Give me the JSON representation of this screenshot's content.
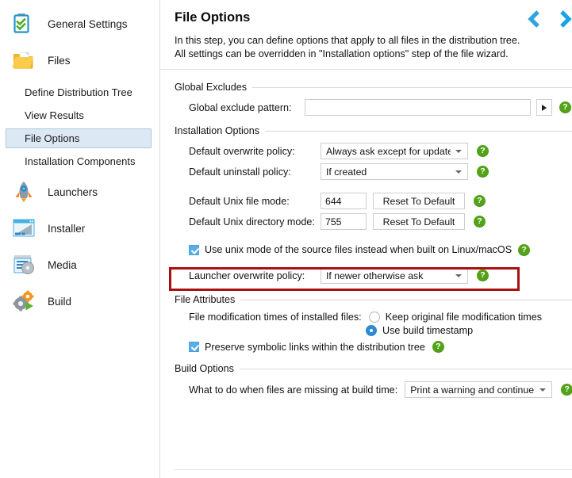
{
  "sidebar": {
    "items": [
      {
        "label": "General Settings",
        "icon": "clipboard-check-icon",
        "type": "major",
        "selected": false
      },
      {
        "label": "Files",
        "icon": "folder-open-icon",
        "type": "major",
        "selected": false
      },
      {
        "label": "Define Distribution Tree",
        "icon": "",
        "type": "sub",
        "selected": false
      },
      {
        "label": "View Results",
        "icon": "",
        "type": "sub",
        "selected": false
      },
      {
        "label": "File Options",
        "icon": "",
        "type": "sub",
        "selected": true
      },
      {
        "label": "Installation Components",
        "icon": "",
        "type": "sub",
        "selected": false
      },
      {
        "label": "Launchers",
        "icon": "rocket-icon",
        "type": "major",
        "selected": false
      },
      {
        "label": "Installer",
        "icon": "window-icon",
        "type": "major",
        "selected": false
      },
      {
        "label": "Media",
        "icon": "disc-icon",
        "type": "major",
        "selected": false
      },
      {
        "label": "Build",
        "icon": "gears-play-icon",
        "type": "major",
        "selected": false
      }
    ]
  },
  "header": {
    "title": "File Options",
    "description_line1": "In this step, you can define options that apply to all files in the distribution tree.",
    "description_line2": "All settings can be overridden in \"Installation options\" step of the file wizard.",
    "prev_label": "‹",
    "next_label": "›"
  },
  "groups": {
    "global_excludes": {
      "title": "Global Excludes",
      "global_exclude_pattern": {
        "label": "Global exclude pattern:",
        "value": "",
        "placeholder": ""
      }
    },
    "installation_options": {
      "title": "Installation Options",
      "default_overwrite_policy": {
        "label": "Default overwrite policy:",
        "value": "Always ask except for update"
      },
      "default_uninstall_policy": {
        "label": "Default uninstall policy:",
        "value": "If created"
      },
      "default_unix_file_mode": {
        "label": "Default Unix file mode:",
        "value": "644",
        "reset_label": "Reset To Default"
      },
      "default_unix_directory_mode": {
        "label": "Default Unix directory mode:",
        "value": "755",
        "reset_label": "Reset To Default"
      },
      "use_unix_mode": {
        "label": "Use unix mode of the source files instead when built on Linux/macOS",
        "checked": true
      },
      "launcher_overwrite_policy": {
        "label": "Launcher overwrite policy:",
        "value": "If newer otherwise ask"
      }
    },
    "file_attributes": {
      "title": "File Attributes",
      "file_modification_times": {
        "label": "File modification times of installed files:",
        "option_keep": "Keep original file modification times",
        "option_build": "Use build timestamp",
        "selected": "Use build timestamp"
      },
      "preserve_symlinks": {
        "label": "Preserve symbolic links within the distribution tree",
        "checked": true
      }
    },
    "build_options": {
      "title": "Build Options",
      "missing_files": {
        "label": "What to do when files are missing at build time:",
        "value": "Print a warning and continue"
      }
    }
  },
  "icons": {
    "help": "?",
    "expand_pattern": "▶"
  },
  "colors": {
    "selection": "#dce9f5",
    "help_green": "#53a318",
    "highlight_red": "#a8110f",
    "accent_blue": "#29a3e3"
  }
}
